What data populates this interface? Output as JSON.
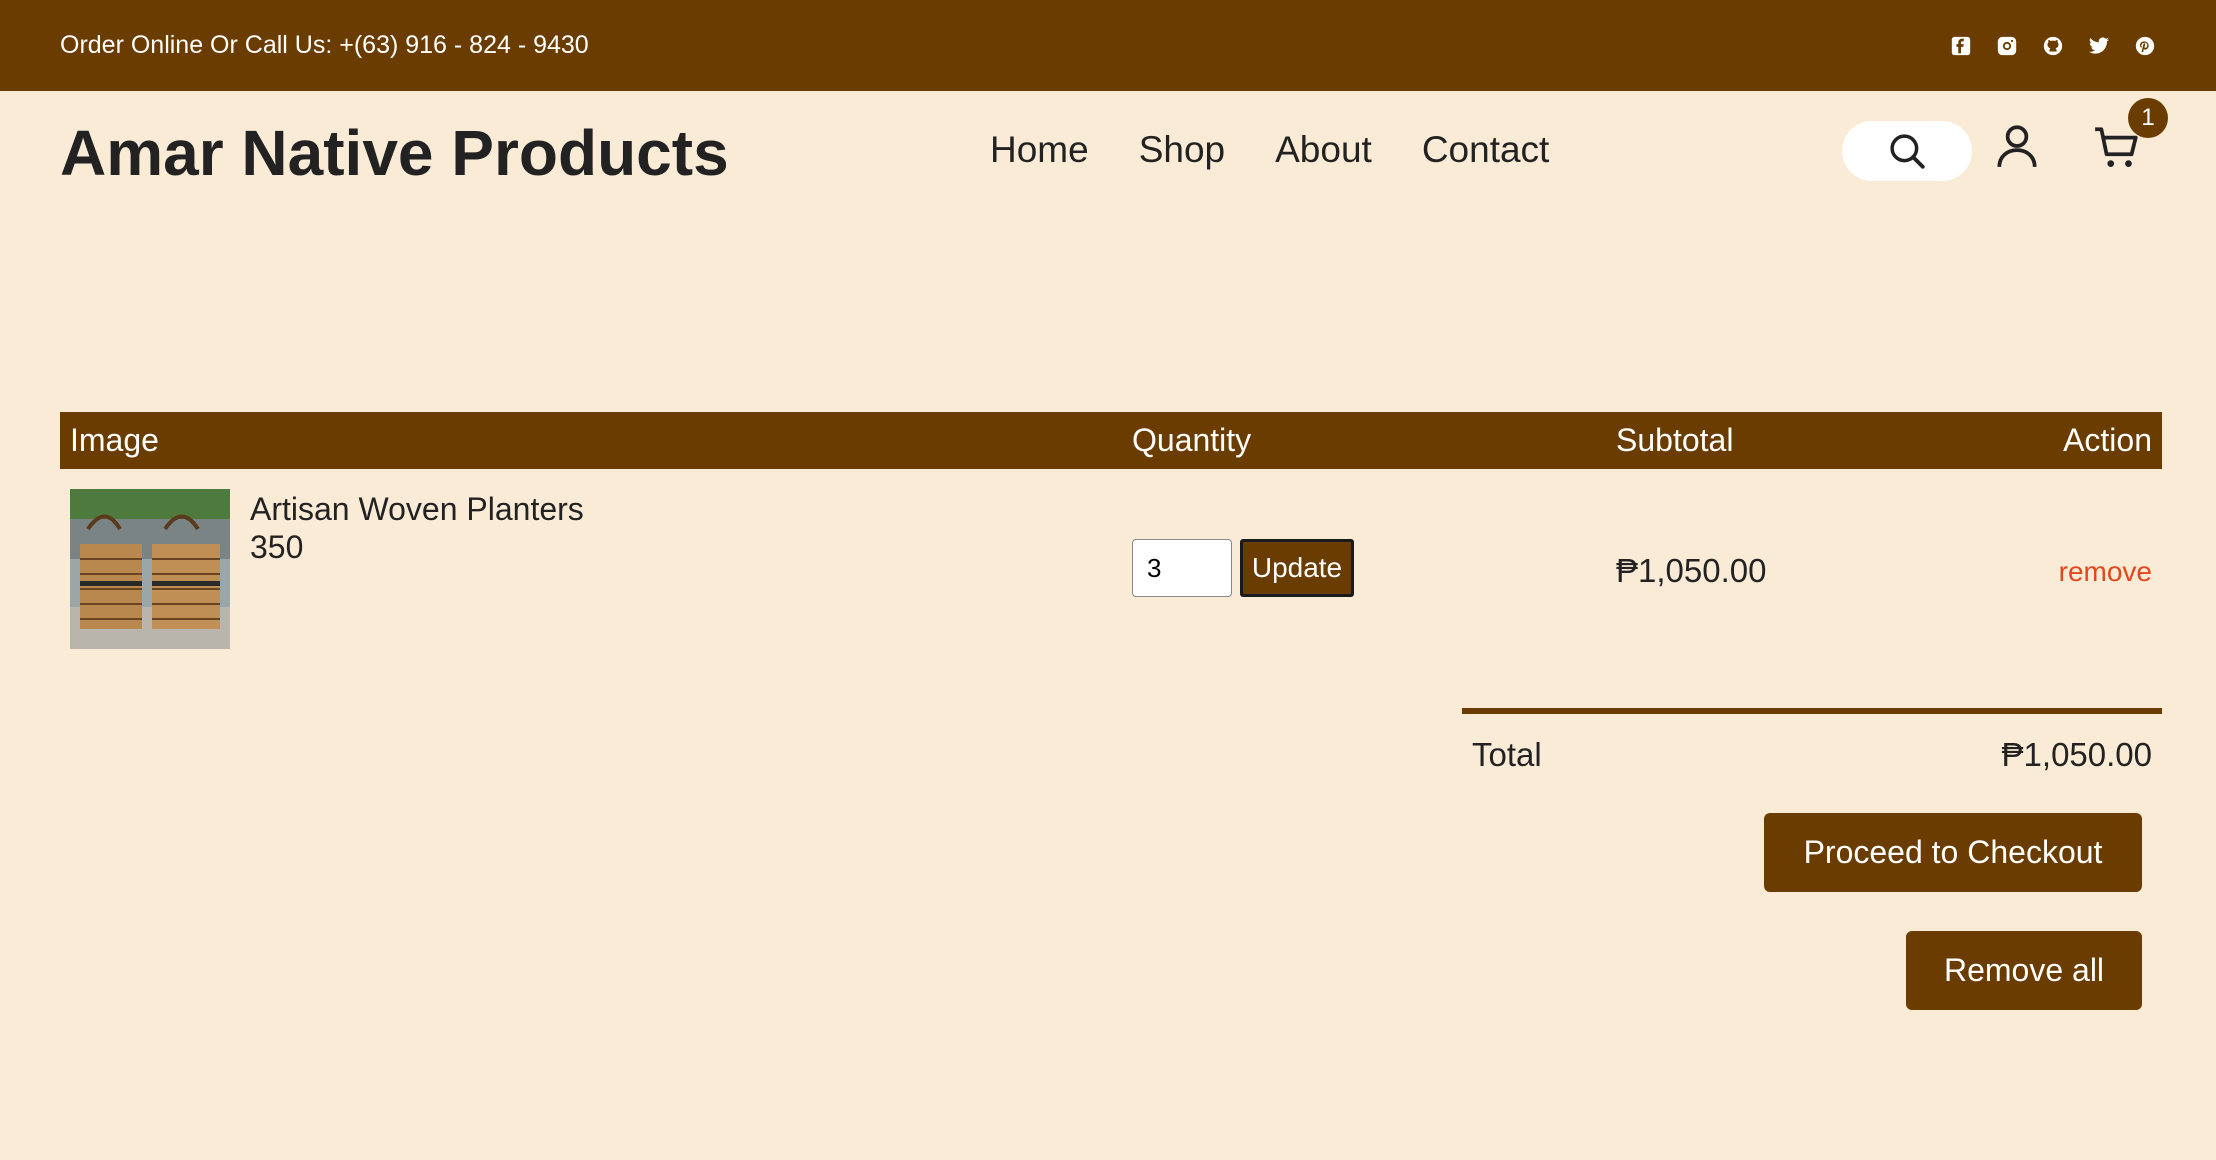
{
  "topbar": {
    "contact_text": "Order Online Or Call Us: +(63) 916 - 824 - 9430",
    "social_icons": [
      "facebook-icon",
      "instagram-icon",
      "github-icon",
      "twitter-icon",
      "pinterest-icon"
    ]
  },
  "header": {
    "brand": "Amar Native Products",
    "nav": [
      "Home",
      "Shop",
      "About",
      "Contact"
    ],
    "cart_count": "1"
  },
  "cart": {
    "columns": {
      "image": "Image",
      "quantity": "Quantity",
      "subtotal": "Subtotal",
      "action": "Action"
    },
    "items": [
      {
        "name": "Artisan Woven Planters",
        "price": "350",
        "quantity": "3",
        "update_label": "Update",
        "subtotal": "₱1,050.00",
        "remove_label": "remove"
      }
    ]
  },
  "summary": {
    "total_label": "Total",
    "total_value": "₱1,050.00",
    "checkout_label": "Proceed to Checkout",
    "remove_all_label": "Remove all"
  },
  "colors": {
    "brand_brown": "#6b3c00",
    "background": "#faebd7",
    "remove_link": "#e4471d"
  }
}
